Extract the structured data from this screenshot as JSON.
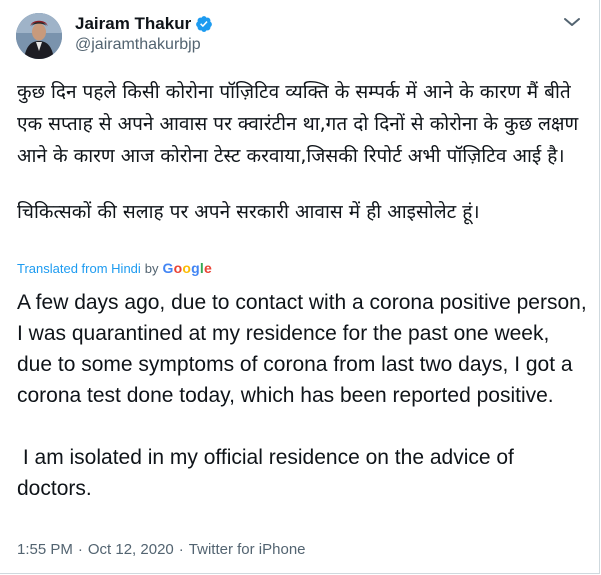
{
  "author": {
    "name": "Jairam Thakur",
    "handle": "@jairamthakurbjp",
    "verified": true
  },
  "icons": {
    "verified": "verified-badge-icon",
    "more": "chevron-down-icon",
    "avatar": "profile-photo"
  },
  "colors": {
    "accent": "#1d9bf0",
    "secondary_text": "#536471",
    "primary_text": "#0f1419"
  },
  "tweet": {
    "hindi_paragraph_1": "कुछ दिन पहले किसी कोरोना पॉज़िटिव व्यक्ति के सम्पर्क में आने के कारण मैं बीते एक सप्ताह से अपने आवास पर क्वारंटीन था,गत दो दिनों से कोरोना के कुछ लक्षण आने के कारण आज कोरोना टेस्ट करवाया,जिसकी रिपोर्ट अभी पॉज़िटिव आई है।",
    "hindi_paragraph_2": "चिकित्सकों की सलाह पर अपने सरकारी आवास में ही आइसोलेट हूं।",
    "translation_label": "Translated from Hindi",
    "translation_by": "by",
    "translation_provider": "Google",
    "english_paragraph_1": "A few days ago, due to contact with a corona positive person, I was quarantined at my residence for the past one week, due to some symptoms of corona from last two days, I got a corona test done today, which has been reported positive.",
    "english_paragraph_2": " I am isolated in my official residence on the advice of doctors."
  },
  "meta": {
    "time": "1:55 PM",
    "separator_1": "·",
    "date": "Oct 12, 2020",
    "separator_2": "·",
    "source": "Twitter for iPhone"
  }
}
